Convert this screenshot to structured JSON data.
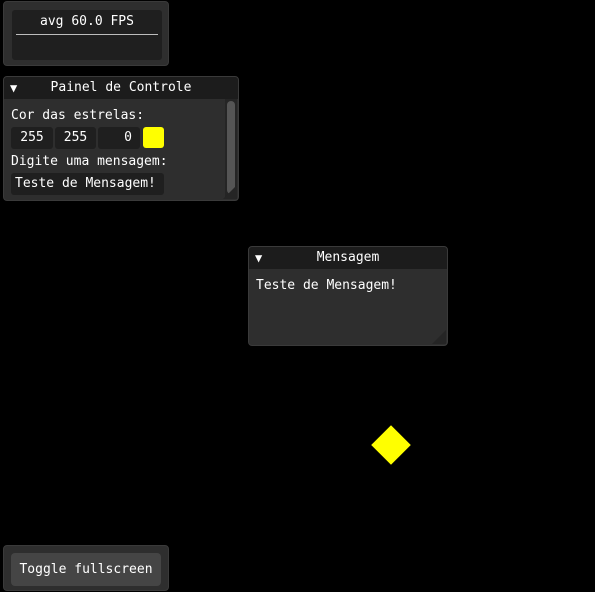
{
  "fps_window": {
    "fps_text": "avg 60.0 FPS"
  },
  "control_panel": {
    "title": "Painel de Controle",
    "color_label": "Cor das estrelas:",
    "color_values": [
      "255",
      "255",
      "0"
    ],
    "swatch_color": "#ffff00",
    "message_label": "Digite uma mensagem:",
    "message_value": "Teste de Mensagem!"
  },
  "message_window": {
    "title": "Mensagem",
    "body": "Teste de Mensagem!"
  },
  "star": {
    "color": "#ffff00"
  },
  "fullscreen_window": {
    "button_label": "Toggle fullscreen"
  },
  "icons": {
    "collapse": "triangle-down-icon"
  }
}
